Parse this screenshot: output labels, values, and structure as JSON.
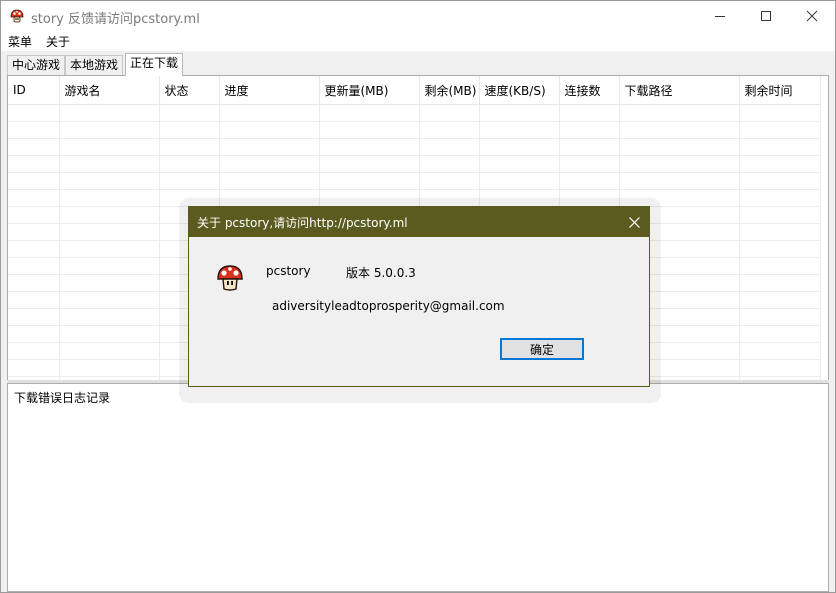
{
  "window": {
    "title": "story 反馈请访问pcstory.ml"
  },
  "menu": {
    "items": [
      "菜单",
      "关于"
    ]
  },
  "tabs": [
    "中心游戏",
    "本地游戏",
    "正在下载"
  ],
  "active_tab": "正在下载",
  "table": {
    "columns": [
      "ID",
      "游戏名",
      "状态",
      "进度",
      "更新量(MB)",
      "剩余(MB)",
      "速度(KB/S)",
      "连接数",
      "下载路径",
      "剩余时间"
    ],
    "rows": []
  },
  "log": {
    "label": "下载错误日志记录"
  },
  "dialog": {
    "title": "关于 pcstory,请访问http://pcstory.ml",
    "app_name": "pcstory",
    "version_label": "版本 5.0.0.3",
    "email": "adiversityleadtoprosperity@gmail.com",
    "ok_label": "确定",
    "icon": "mushroom-icon"
  },
  "colors": {
    "dialog_title_bg": "#5b5b20",
    "button_focus": "#0078d7",
    "mushroom_red": "#d8301c"
  }
}
